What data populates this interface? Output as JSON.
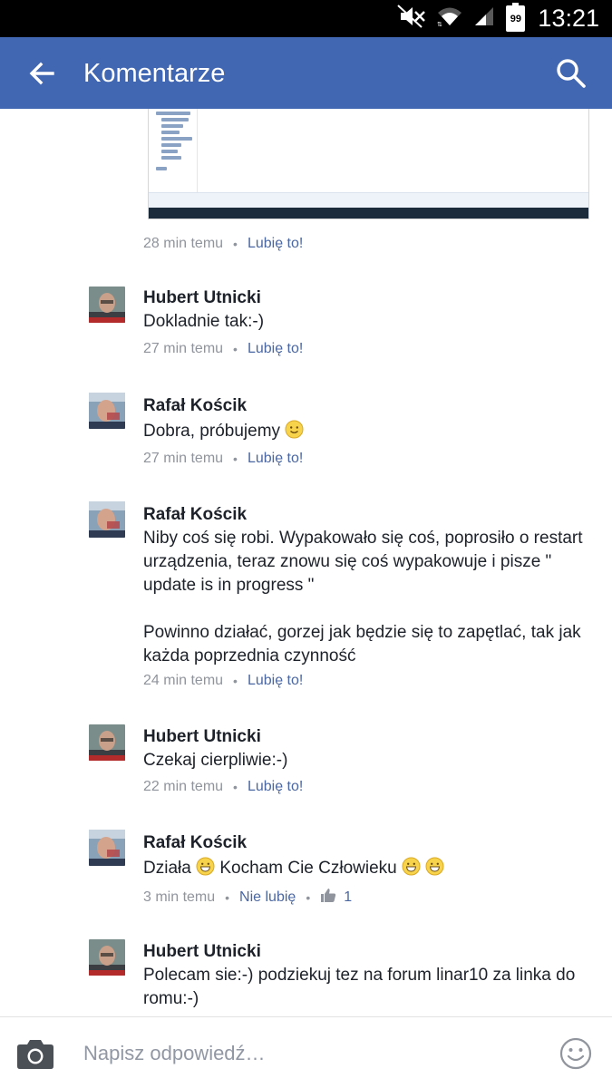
{
  "status_bar": {
    "time": "13:21",
    "battery": "99",
    "icons": [
      "mute-icon",
      "wifi-icon",
      "signal-icon",
      "battery-icon"
    ]
  },
  "app_bar": {
    "title": "Komentarze",
    "back_icon": "arrow-left-icon",
    "search_icon": "search-icon",
    "background": "#4267b2"
  },
  "first_meta": {
    "time": "28 min temu",
    "action": "Lubię to!"
  },
  "comments": [
    {
      "author": "Hubert Utnicki",
      "paragraphs": [
        "Dokladnie tak:-)"
      ],
      "time": "27 min temu",
      "action": "Lubię to!"
    },
    {
      "author": "Rafał Kościk",
      "paragraphs": [
        "Dobra, próbujemy"
      ],
      "time": "27 min temu",
      "action": "Lubię to!"
    },
    {
      "author": "Rafał Kościk",
      "paragraphs": [
        "Niby coś się robi. Wypakowało się coś, poprosiło o restart urządzenia, teraz znowu się coś wypakowuje i pisze \" update is in progress \"",
        "Powinno działać, gorzej jak będzie się to zapętlać, tak jak każda poprzednia czynność"
      ],
      "time": "24 min temu",
      "action": "Lubię to!"
    },
    {
      "author": "Hubert Utnicki",
      "paragraphs": [
        "Czekaj cierpliwie:-)"
      ],
      "time": "22 min temu",
      "action": "Lubię to!"
    },
    {
      "author": "Rafał Kościk",
      "paragraphs": [
        "Działa",
        "Kocham Cie Człowieku"
      ],
      "time": "3 min temu",
      "action": "Nie lubię",
      "like_count": "1"
    },
    {
      "author": "Hubert Utnicki",
      "paragraphs": [
        "Polecam sie:-) podziekuj tez na forum linar10 za linka do romu:-)"
      ]
    }
  ],
  "reply_bar": {
    "placeholder": "Napisz odpowiedź…",
    "camera_icon": "camera-icon",
    "emoji_icon": "smiley-icon"
  },
  "colors": {
    "link": "#4b67a1",
    "meta": "#90949c",
    "text": "#1d2129"
  }
}
